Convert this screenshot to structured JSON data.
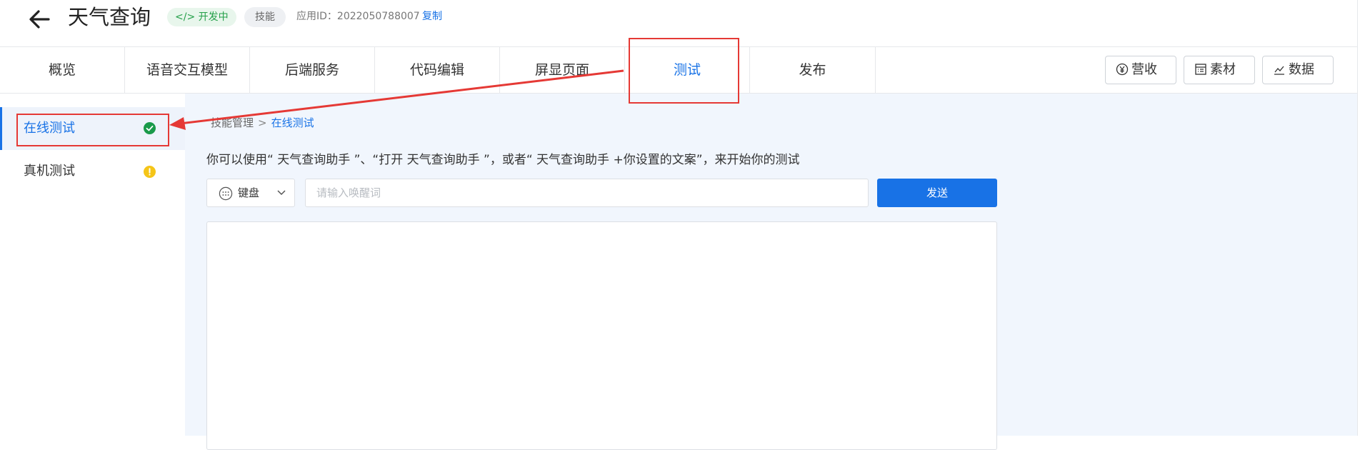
{
  "header": {
    "title": "天气查询",
    "status_badge": "开发中",
    "type_badge": "技能",
    "app_id_label": "应用ID：2022050788007",
    "copy_label": "复制"
  },
  "nav": {
    "tabs": [
      {
        "label": "概览"
      },
      {
        "label": "语音交互模型"
      },
      {
        "label": "后端服务"
      },
      {
        "label": "代码编辑"
      },
      {
        "label": "屏显页面"
      },
      {
        "label": "测试"
      },
      {
        "label": "发布"
      }
    ],
    "active_tab": "测试",
    "tools": [
      {
        "label": "营收",
        "icon": "yen-icon"
      },
      {
        "label": "素材",
        "icon": "document-list-icon"
      },
      {
        "label": "数据",
        "icon": "line-chart-icon"
      }
    ]
  },
  "sidebar": {
    "items": [
      {
        "label": "在线测试",
        "status": "passed",
        "status_color": "#1a9a4a"
      },
      {
        "label": "真机测试",
        "status": "warning",
        "status_color": "#f5c518"
      }
    ]
  },
  "main": {
    "breadcrumb": {
      "parent": "技能管理",
      "current": "在线测试"
    },
    "hint": "你可以使用“ 天气查询助手 ”、“打开 天气查询助手 ”，或者“ 天气查询助手 +你设置的文案”，来开始你的测试",
    "mode_select": {
      "value": "键盘",
      "icon": "keyboard-icon"
    },
    "wake_input": {
      "value": "",
      "placeholder": "请输入唤醒词"
    },
    "send_label": "发送"
  },
  "colors": {
    "accent": "#1872e6",
    "annotation": "#e53935",
    "main_bg": "#f1f6fd",
    "dev_badge_text": "#25a04a"
  }
}
